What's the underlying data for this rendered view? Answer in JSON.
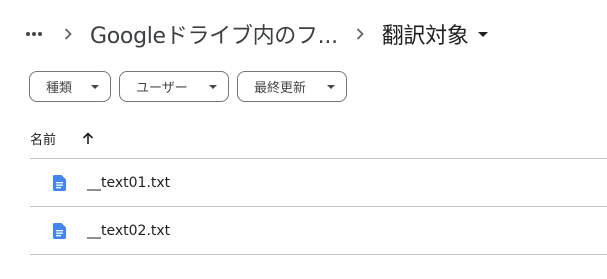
{
  "breadcrumb": {
    "more_icon": "more-horiz-icon",
    "separator_icon": "chevron-right-icon",
    "parent_folder": "Googleドライブ内のフ...",
    "current_folder": "翻訳対象",
    "current_caret_icon": "arrow-drop-down-icon"
  },
  "filters": [
    {
      "label": "種類",
      "icon": "arrow-drop-down-icon"
    },
    {
      "label": "ユーザー",
      "icon": "arrow-drop-down-icon"
    },
    {
      "label": "最終更新",
      "icon": "arrow-drop-down-icon"
    }
  ],
  "list_header": {
    "name_label": "名前",
    "sort_icon": "arrow-upward-icon"
  },
  "files": [
    {
      "name": "__text01.txt",
      "icon": "docs-file-icon"
    },
    {
      "name": "__text02.txt",
      "icon": "docs-file-icon"
    }
  ],
  "colors": {
    "docs_blue": "#4285f4",
    "divider": "#c7c7c7",
    "chip_border": "#747775"
  }
}
